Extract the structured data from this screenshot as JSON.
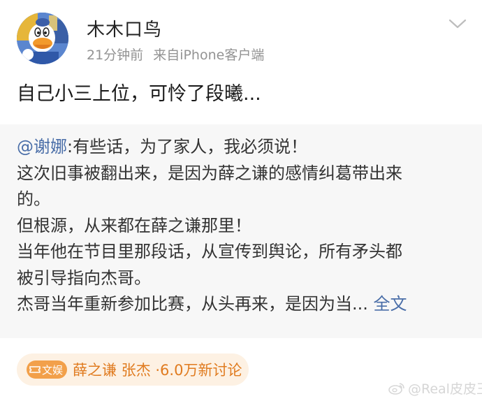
{
  "post": {
    "author": "木木口鸟",
    "time": "21分钟前",
    "source": "来自iPhone客户端",
    "text": "自己小三上位，可怜了段曦..."
  },
  "repost": {
    "mention": "@谢娜",
    "lines": [
      ":有些话，为了家人，我必须说！",
      "这次旧事被翻出来，是因为薛之谦的感情纠葛带出来",
      "的。",
      "但根源，从来都在薛之谦那里！",
      "当年他在节目里那段话，从宣传到舆论，所有矛头都",
      "被引导指向杰哥。",
      "杰哥当年重新参加比赛，从头再来，是因为当... "
    ],
    "full_text_link": "全文"
  },
  "topic": {
    "badge": "文娱",
    "text": "薛之谦 张杰 ·6.0万新讨论"
  },
  "watermark": {
    "text": "@Real皮皮王"
  },
  "icons": {
    "avatar": "donald-duck-avatar",
    "chevron": "chevron-down-icon",
    "badge_icon": "ticket-icon",
    "watermark_icon": "weibo-logo"
  },
  "colors": {
    "link": "#4a6ea8",
    "topic_text": "#e07b1f",
    "topic_badge": "#f2a04a",
    "repost_bg": "#f7f7f7"
  }
}
